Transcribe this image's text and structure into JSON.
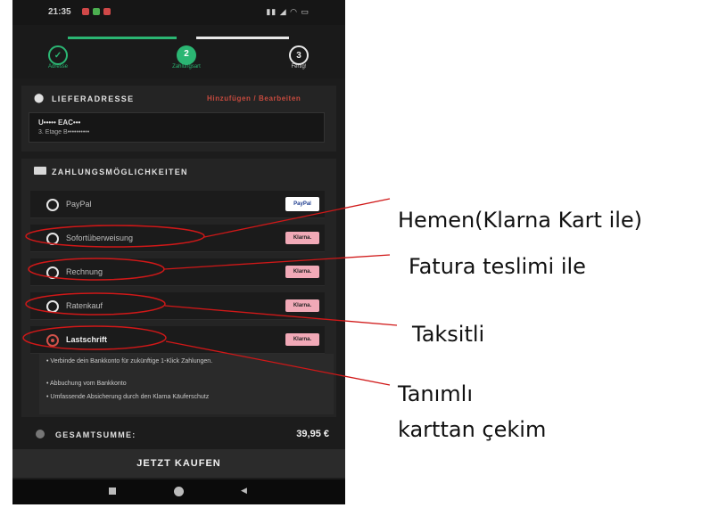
{
  "statusbar": {
    "time": "21:35"
  },
  "stepper": {
    "steps": [
      {
        "label": "Adresse",
        "number": ""
      },
      {
        "label": "Zahlungsart",
        "number": "2"
      },
      {
        "label": "Fertig!",
        "number": "3"
      }
    ]
  },
  "address": {
    "title": "LIEFERADRESSE",
    "action": "Hinzufügen / Bearbeiten",
    "line1": "U••••• EAC•••",
    "line2": "3. Etage B••••••••••"
  },
  "payment": {
    "title": "ZAHLUNGSMÖGLICHKEITEN",
    "options": [
      {
        "label": "PayPal",
        "badge": "PayPal"
      },
      {
        "label": "Sofortüberweisung",
        "badge": "Klarna."
      },
      {
        "label": "Rechnung",
        "badge": "Klarna."
      },
      {
        "label": "Ratenkauf",
        "badge": "Klarna."
      },
      {
        "label": "Lastschrift",
        "badge": "Klarna."
      }
    ],
    "selected": "Lastschrift",
    "details": [
      "Verbinde dein Bankkonto für zukünftige 1-Klick Zahlungen.",
      "Abbuchung vom Bankkonto",
      "Umfassende Absicherung durch den Klarna Käuferschutz"
    ]
  },
  "summary": {
    "label": "GESAMTSUMME:",
    "amount": "39,95 €"
  },
  "buy_button": "JETZT KAUFEN",
  "annotations": {
    "sofort": "Hemen(Klarna Kart ile)",
    "rechnung": "Fatura teslimi ile",
    "ratenkauf": "Taksitli",
    "lastschrift_line1": "Tanımlı",
    "lastschrift_line2": "karttan çekim"
  },
  "colors": {
    "accent_green": "#2bb673",
    "accent_red": "#d0524a",
    "klarna_pink": "#f1a9b7"
  }
}
